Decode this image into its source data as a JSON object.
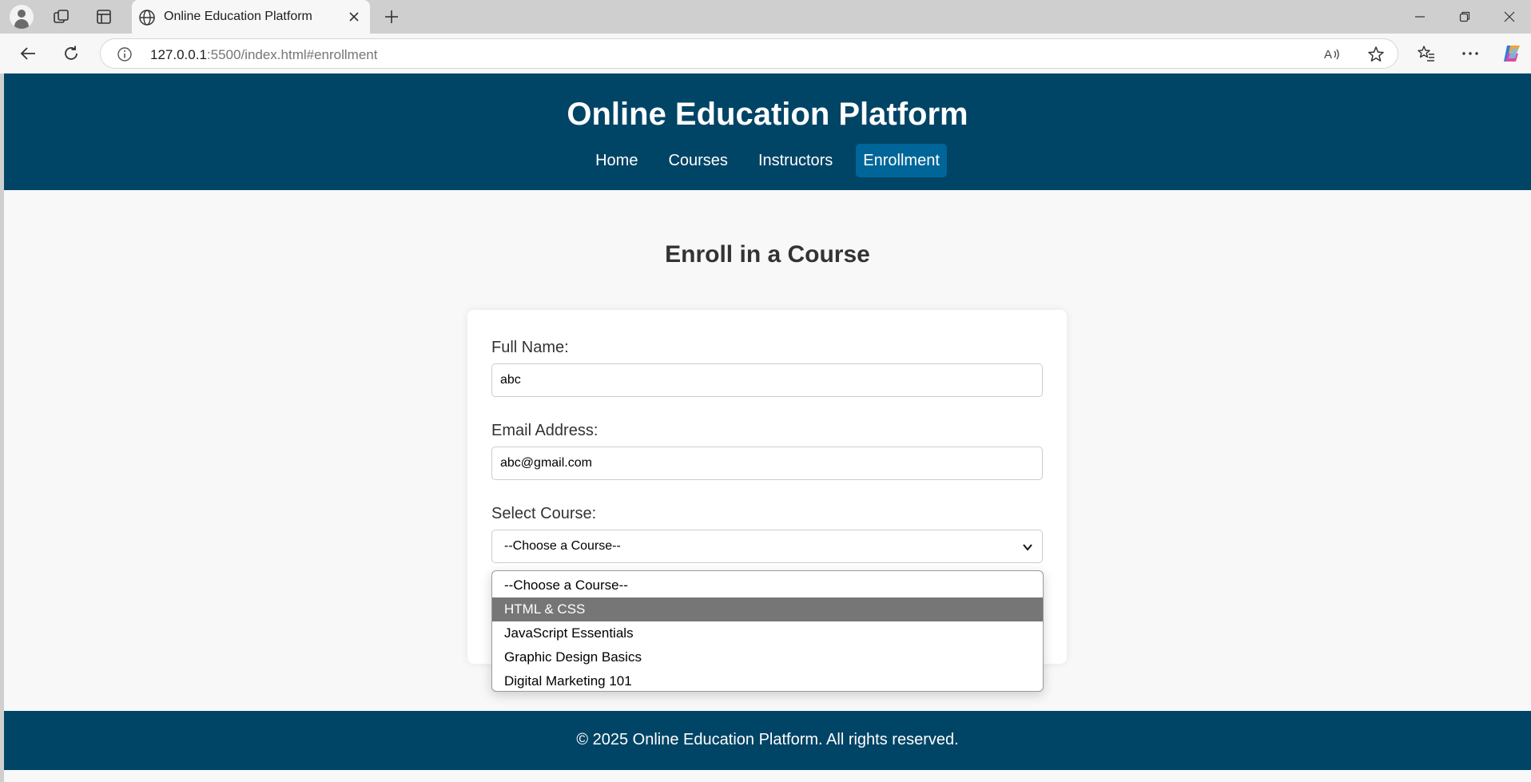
{
  "browser": {
    "tab_title": "Online Education Platform",
    "url_host": "127.0.0.1",
    "url_rest": ":5500/index.html#enrollment"
  },
  "site": {
    "title": "Online Education Platform",
    "nav": [
      {
        "label": "Home",
        "active": false
      },
      {
        "label": "Courses",
        "active": false
      },
      {
        "label": "Instructors",
        "active": false
      },
      {
        "label": "Enrollment",
        "active": true
      }
    ],
    "brand_color": "#004466",
    "active_nav_color": "#006699"
  },
  "enrollment": {
    "heading": "Enroll in a Course",
    "full_name_label": "Full Name:",
    "full_name_value": "abc",
    "email_label": "Email Address:",
    "email_value": "abc@gmail.com",
    "course_label": "Select Course:",
    "course_selected": "--Choose a Course--",
    "course_options": [
      {
        "label": "--Choose a Course--",
        "highlighted": false
      },
      {
        "label": "HTML & CSS",
        "highlighted": true
      },
      {
        "label": "JavaScript Essentials",
        "highlighted": false
      },
      {
        "label": "Graphic Design Basics",
        "highlighted": false
      },
      {
        "label": "Digital Marketing 101",
        "highlighted": false
      }
    ]
  },
  "footer": {
    "text": "© 2025 Online Education Platform. All rights reserved."
  }
}
